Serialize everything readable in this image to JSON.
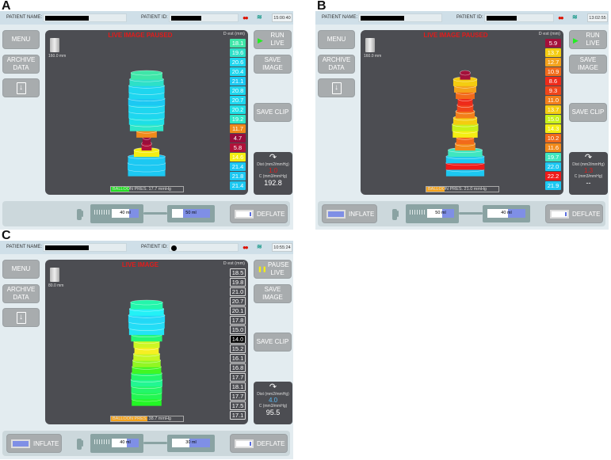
{
  "labels": {
    "patient_name": "PATIENT NAME:",
    "patient_id": "PATIENT ID:",
    "menu": "MENU",
    "archive": "ARCHIVE DATA",
    "save_image": "SAVE IMAGE",
    "save_clip": "SAVE CLIP",
    "dest_header": "D est (mm)",
    "dist_label": "Dist (mm2/mmHg)",
    "c_label": "C (mm3/mmHg)",
    "inflate": "INFLATE",
    "deflate": "DEFLATE",
    "download_icon": "download-icon",
    "glasses_icon": "glasses-icon",
    "wave_icon": "waveform-icon"
  },
  "panels": [
    {
      "letter": "A",
      "time": "15:00:40",
      "id_type": "redacted",
      "live_title": "LIVE IMAGE PAUSED",
      "live_button": "RUN LIVE",
      "live_state": "paused",
      "scale_label": "160.0 mm",
      "cell_style": "filled",
      "diameters": [
        "18.1",
        "19.6",
        "20.6",
        "20.4",
        "21.1",
        "20.8",
        "20.7",
        "20.2",
        "19.2",
        "11.7",
        "4.7",
        "5.8",
        "14.6",
        "21.4",
        "21.8",
        "21.4"
      ],
      "cell_colors": [
        "#3fe6a8",
        "#2ee0c8",
        "#1ed6ef",
        "#1ed6ef",
        "#1cc8f2",
        "#1ed6ef",
        "#1ed6ef",
        "#1edfe6",
        "#2ee6c8",
        "#f08a1a",
        "#9a0d3c",
        "#b0123a",
        "#f4ee12",
        "#1cc8f2",
        "#1cc8f2",
        "#1cc8f2"
      ],
      "pressure": "BALLOON PRES. 17.7 mmHg",
      "pressure_fill_color": "#22dd22",
      "pressure_fill": 0.25,
      "dist": "1.0",
      "dist_color": "#e31b1b",
      "compliance": "192.8",
      "show_inflate": false,
      "syringe_ml": "40 ml",
      "syringe_fill": 0.35,
      "reservoir_ml": "50 ml",
      "reservoir_fill": 0.7
    },
    {
      "letter": "B",
      "time": "13:02:55",
      "id_type": "redacted",
      "live_title": "LIVE IMAGE PAUSED",
      "live_button": "RUN LIVE",
      "live_state": "paused",
      "scale_label": "160.0 mm",
      "cell_style": "filled",
      "diameters": [
        "5.9",
        "13.7",
        "12.7",
        "10.9",
        "8.6",
        "9.3",
        "11.0",
        "13.7",
        "15.0",
        "14.3",
        "10.2",
        "11.6",
        "19.7",
        "22.0",
        "22.2",
        "21.9"
      ],
      "cell_colors": [
        "#a3103a",
        "#f4cc10",
        "#f4a21a",
        "#f26a1a",
        "#ee2a1a",
        "#f0441a",
        "#f27e1a",
        "#f4cc10",
        "#c8f018",
        "#f4ee12",
        "#f26a1a",
        "#f28a1a",
        "#3fe6c0",
        "#1cc8f2",
        "#ee1a1a",
        "#1cc8f2"
      ],
      "pressure": "BALLOON PRES. 21.0 mmHg",
      "pressure_fill_color": "#f4a21a",
      "pressure_fill": 0.25,
      "dist": "1.3",
      "dist_color": "#e31b1b",
      "compliance": "--",
      "show_inflate": true,
      "syringe_ml": "50 ml",
      "syringe_fill": 0.45,
      "reservoir_ml": "40 ml",
      "reservoir_fill": 0.45
    },
    {
      "letter": "C",
      "time": "10:55:24",
      "id_type": "dot",
      "live_title": "LIVE IMAGE",
      "live_button": "PAUSE LIVE",
      "live_state": "live",
      "scale_label": "80.0 mm",
      "cell_style": "outline",
      "selected_index": 7,
      "diameters": [
        "18.5",
        "19.8",
        "21.0",
        "20.7",
        "20.1",
        "17.8",
        "15.0",
        "14.0",
        "15.2",
        "16.1",
        "16.8",
        "17.7",
        "18.1",
        "17.7",
        "17.5",
        "17.1"
      ],
      "pressure": "BALLOON PRES. 38.7 mmHg",
      "pressure_fill_color": "#f4a21a",
      "pressure_fill": 0.5,
      "dist": "4.0",
      "dist_color": "#5ab8f0",
      "compliance": "95.5",
      "show_inflate": true,
      "syringe_ml": "40 ml",
      "syringe_fill": 0.45,
      "reservoir_ml": "30 ml",
      "reservoir_fill": 0.55
    }
  ]
}
